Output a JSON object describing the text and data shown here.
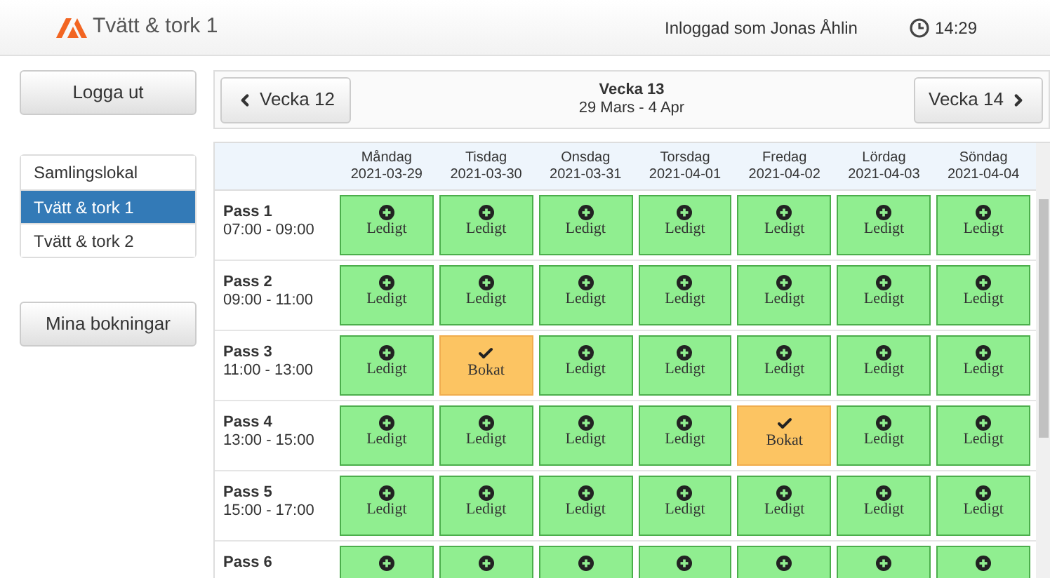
{
  "header": {
    "title": "Tvätt & tork 1",
    "user": "Inloggad som Jonas Åhlin",
    "time": "14:29"
  },
  "sidebar": {
    "logout": "Logga ut",
    "rooms": [
      {
        "label": "Samlingslokal",
        "selected": false
      },
      {
        "label": "Tvätt & tork 1",
        "selected": true
      },
      {
        "label": "Tvätt & tork 2",
        "selected": false
      }
    ],
    "my_bookings": "Mina bokningar"
  },
  "week_nav": {
    "prev": "Vecka 12",
    "title": "Vecka 13",
    "range": "29 Mars - 4 Apr",
    "next": "Vecka 14"
  },
  "days": [
    {
      "name": "Måndag",
      "date": "2021-03-29"
    },
    {
      "name": "Tisdag",
      "date": "2021-03-30"
    },
    {
      "name": "Onsdag",
      "date": "2021-03-31"
    },
    {
      "name": "Torsdag",
      "date": "2021-04-01"
    },
    {
      "name": "Fredag",
      "date": "2021-04-02"
    },
    {
      "name": "Lördag",
      "date": "2021-04-03"
    },
    {
      "name": "Söndag",
      "date": "2021-04-04"
    }
  ],
  "passes": [
    {
      "name": "Pass 1",
      "time": "07:00 - 09:00",
      "cells": [
        {
          "kind": "free",
          "label": "Ledigt"
        },
        {
          "kind": "free",
          "label": "Ledigt"
        },
        {
          "kind": "free",
          "label": "Ledigt"
        },
        {
          "kind": "free",
          "label": "Ledigt"
        },
        {
          "kind": "free",
          "label": "Ledigt"
        },
        {
          "kind": "free",
          "label": "Ledigt"
        },
        {
          "kind": "free",
          "label": "Ledigt"
        }
      ]
    },
    {
      "name": "Pass 2",
      "time": "09:00 - 11:00",
      "cells": [
        {
          "kind": "free",
          "label": "Ledigt"
        },
        {
          "kind": "free",
          "label": "Ledigt"
        },
        {
          "kind": "free",
          "label": "Ledigt"
        },
        {
          "kind": "free",
          "label": "Ledigt"
        },
        {
          "kind": "free",
          "label": "Ledigt"
        },
        {
          "kind": "free",
          "label": "Ledigt"
        },
        {
          "kind": "free",
          "label": "Ledigt"
        }
      ]
    },
    {
      "name": "Pass 3",
      "time": "11:00 - 13:00",
      "cells": [
        {
          "kind": "free",
          "label": "Ledigt"
        },
        {
          "kind": "booked",
          "label": "Bokat"
        },
        {
          "kind": "free",
          "label": "Ledigt"
        },
        {
          "kind": "free",
          "label": "Ledigt"
        },
        {
          "kind": "free",
          "label": "Ledigt"
        },
        {
          "kind": "free",
          "label": "Ledigt"
        },
        {
          "kind": "free",
          "label": "Ledigt"
        }
      ]
    },
    {
      "name": "Pass 4",
      "time": "13:00 - 15:00",
      "cells": [
        {
          "kind": "free",
          "label": "Ledigt"
        },
        {
          "kind": "free",
          "label": "Ledigt"
        },
        {
          "kind": "free",
          "label": "Ledigt"
        },
        {
          "kind": "free",
          "label": "Ledigt"
        },
        {
          "kind": "booked",
          "label": "Bokat"
        },
        {
          "kind": "free",
          "label": "Ledigt"
        },
        {
          "kind": "free",
          "label": "Ledigt"
        }
      ]
    },
    {
      "name": "Pass 5",
      "time": "15:00 - 17:00",
      "cells": [
        {
          "kind": "free",
          "label": "Ledigt"
        },
        {
          "kind": "free",
          "label": "Ledigt"
        },
        {
          "kind": "free",
          "label": "Ledigt"
        },
        {
          "kind": "free",
          "label": "Ledigt"
        },
        {
          "kind": "free",
          "label": "Ledigt"
        },
        {
          "kind": "free",
          "label": "Ledigt"
        },
        {
          "kind": "free",
          "label": "Ledigt"
        }
      ]
    },
    {
      "name": "Pass 6",
      "cells": [
        {
          "kind": "free"
        },
        {
          "kind": "free"
        },
        {
          "kind": "free"
        },
        {
          "kind": "free"
        },
        {
          "kind": "free"
        },
        {
          "kind": "free"
        },
        {
          "kind": "free"
        }
      ]
    }
  ]
}
